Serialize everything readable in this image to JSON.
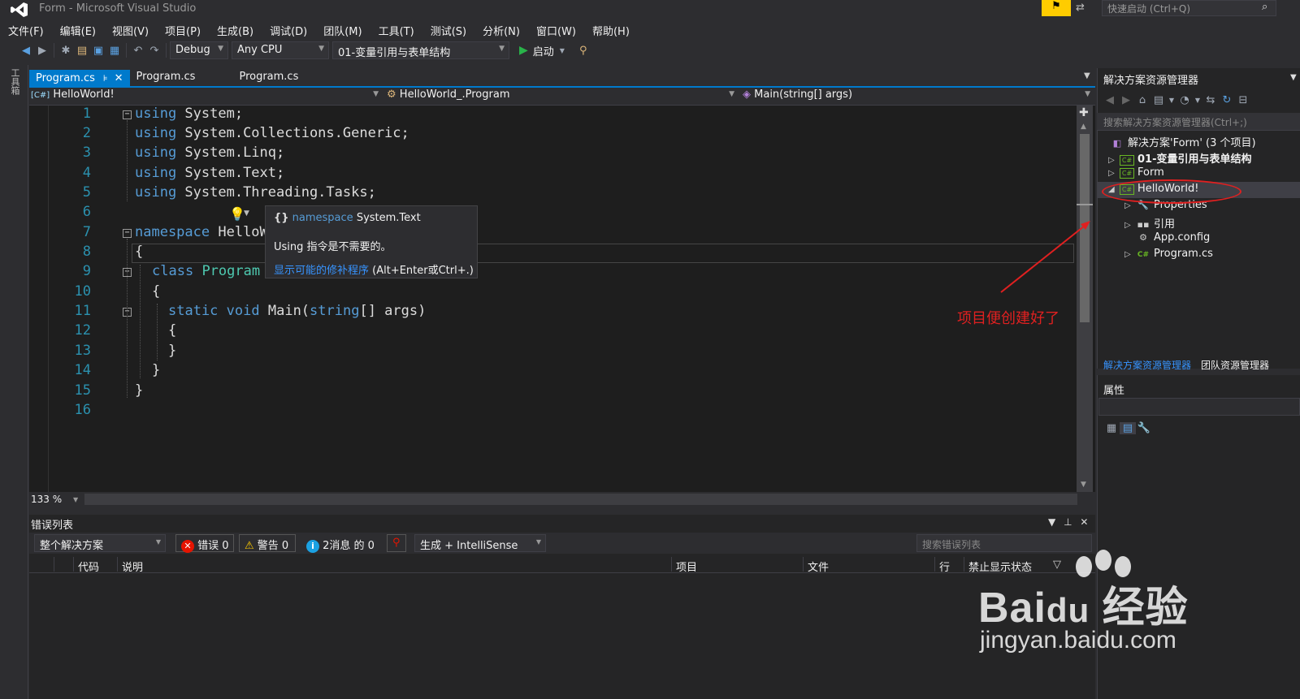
{
  "window": {
    "title": "Form - Microsoft Visual Studio",
    "quick_launch_placeholder": "快速启动 (Ctrl+Q)"
  },
  "menu": [
    "文件(F)",
    "编辑(E)",
    "视图(V)",
    "项目(P)",
    "生成(B)",
    "调试(D)",
    "团队(M)",
    "工具(T)",
    "测试(S)",
    "分析(N)",
    "窗口(W)",
    "帮助(H)"
  ],
  "toolbar": {
    "config": "Debug",
    "platform": "Any CPU",
    "startup_project": "01-变量引用与表单结构",
    "start_label": "启动"
  },
  "toolbox_tab": "工具箱",
  "editor": {
    "tabs": [
      "Program.cs",
      "Program.cs",
      "Program.cs"
    ],
    "nav": {
      "project": "HelloWorld!",
      "class": "HelloWorld_.Program",
      "member": "Main(string[] args)"
    },
    "zoom": "133 %",
    "line_numbers": [
      "1",
      "2",
      "3",
      "4",
      "5",
      "6",
      "7",
      "8",
      "9",
      "10",
      "11",
      "12",
      "13",
      "14",
      "15",
      "16"
    ],
    "code": {
      "l1": {
        "kw": "using",
        "rest": " System;"
      },
      "l2": {
        "kw": "using",
        "rest": " System.Collections.Generic;"
      },
      "l3": {
        "kw": "using",
        "rest": " System.Linq;"
      },
      "l4": {
        "kw": "using",
        "rest": " System.Text;"
      },
      "l5": {
        "kw": "using",
        "rest": " System.Threading.Tasks;"
      },
      "l7": {
        "kw": "namespace",
        "rest": " HelloW"
      },
      "l8": "{",
      "l9": {
        "kw": "class",
        "type": "Program"
      },
      "l10": "{",
      "l11": {
        "kw1": "static",
        "kw2": "void",
        "name": " Main(",
        "kw3": "string",
        "rest": "[] args)"
      },
      "l12": "{",
      "l13": "}",
      "l14": "}",
      "l15": "}"
    },
    "tooltip": {
      "braces": "{}",
      "ns_kw": "namespace",
      "ns_name": "System.Text",
      "message": "Using 指令是不需要的。",
      "fix_link": "显示可能的修补程序",
      "fix_keys": " (Alt+Enter或Ctrl+.)"
    }
  },
  "error_list": {
    "title": "错误列表",
    "scope": "整个解决方案",
    "errors": "错误 0",
    "warnings": "警告 0",
    "messages": "2消息 的 0",
    "source": "生成 + IntelliSense",
    "search_placeholder": "搜索错误列表",
    "columns": [
      "代码",
      "说明",
      "项目",
      "文件",
      "行",
      "禁止显示状态"
    ]
  },
  "solution_explorer": {
    "title": "解决方案资源管理器",
    "search_placeholder": "搜索解决方案资源管理器(Ctrl+;)",
    "solution": "解决方案'Form' (3 个项目)",
    "items": [
      {
        "label": "01-变量引用与表单结构",
        "bold": true
      },
      {
        "label": "Form"
      },
      {
        "label": "HelloWorld!"
      },
      {
        "label": "Properties"
      },
      {
        "label": "引用"
      },
      {
        "label": "App.config"
      },
      {
        "label": "Program.cs"
      }
    ],
    "tabs": [
      "解决方案资源管理器",
      "团队资源管理器"
    ]
  },
  "properties": {
    "title": "属性"
  },
  "annotation": {
    "text": "项目便创建好了",
    "color": "#e02020"
  },
  "watermark": {
    "brand": "Bai du 经验",
    "url": "jingyan.baidu.com"
  },
  "colors": {
    "accent": "#007acc",
    "keyword": "#569cd6",
    "type": "#4ec9b0",
    "line_number": "#2b91af",
    "play": "#29b34a"
  }
}
